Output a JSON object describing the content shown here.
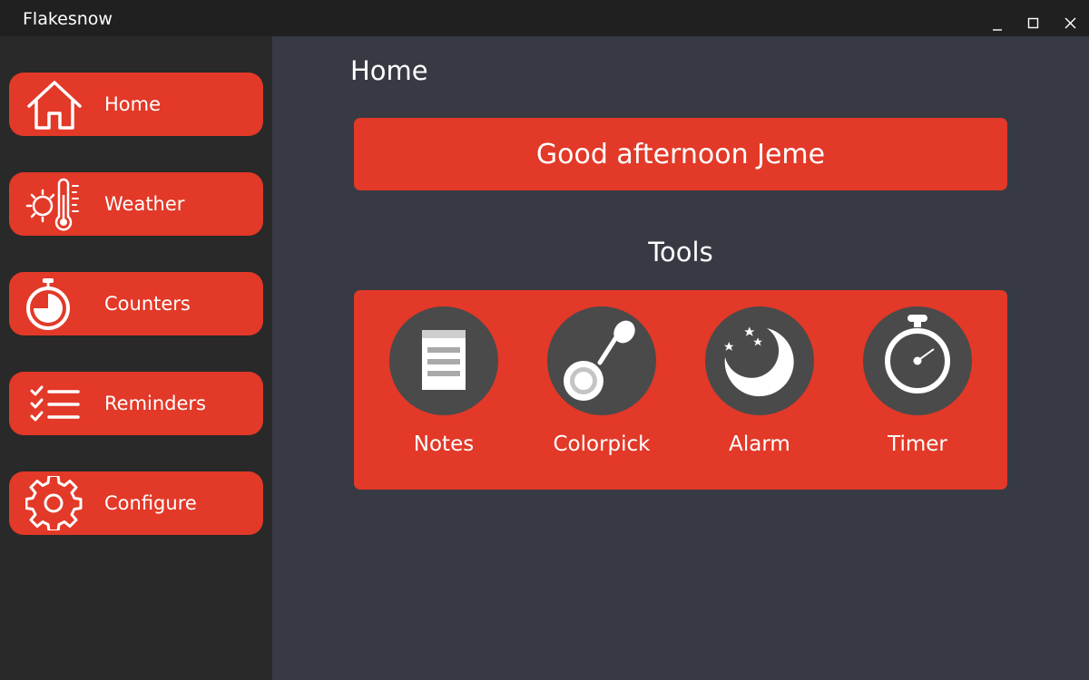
{
  "window": {
    "title": "Flakesnow",
    "controls": {
      "minimize_icon": "minimize-icon",
      "maximize_icon": "maximize-icon",
      "close_icon": "close-icon"
    }
  },
  "sidebar": {
    "items": [
      {
        "label": "Home",
        "icon": "home-icon"
      },
      {
        "label": "Weather",
        "icon": "weather-icon"
      },
      {
        "label": "Counters",
        "icon": "stopwatch-icon"
      },
      {
        "label": "Reminders",
        "icon": "checklist-icon"
      },
      {
        "label": "Configure",
        "icon": "gear-icon"
      }
    ]
  },
  "main": {
    "page_title": "Home",
    "greeting": "Good afternoon Jeme",
    "tools_heading": "Tools",
    "tools": [
      {
        "label": "Notes",
        "icon": "notes-icon"
      },
      {
        "label": "Colorpick",
        "icon": "colorpicker-icon"
      },
      {
        "label": "Alarm",
        "icon": "moon-icon"
      },
      {
        "label": "Timer",
        "icon": "timer-icon"
      }
    ]
  },
  "colors": {
    "accent": "#e23928",
    "sidebar_bg": "#292929",
    "main_bg": "#373a43",
    "titlebar_bg": "#202020",
    "tool_circle": "#4a4a4a"
  }
}
